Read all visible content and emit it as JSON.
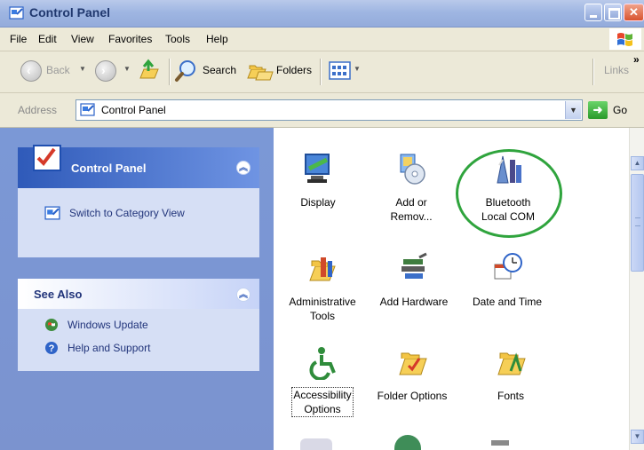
{
  "window": {
    "title": "Control Panel"
  },
  "menu": [
    "File",
    "Edit",
    "View",
    "Favorites",
    "Tools",
    "Help"
  ],
  "toolbar": {
    "back_label": "Back",
    "search_label": "Search",
    "folders_label": "Folders",
    "links_label": "Links",
    "more": "»"
  },
  "address": {
    "label": "Address",
    "value": "Control Panel",
    "go_label": "Go"
  },
  "tasks": {
    "title": "Control Panel",
    "switch_view": "Switch to Category View",
    "see_also_title": "See Also",
    "see_also": [
      "Windows Update",
      "Help and Support"
    ]
  },
  "items": [
    {
      "line1": "Display",
      "line2": ""
    },
    {
      "line1": "Add or",
      "line2": "Remov..."
    },
    {
      "line1": "Bluetooth",
      "line2": "Local COM"
    },
    {
      "line1": "Administrative",
      "line2": "Tools"
    },
    {
      "line1": "Add Hardware",
      "line2": ""
    },
    {
      "line1": "Date and Time",
      "line2": ""
    },
    {
      "line1": "Accessibility",
      "line2": "Options"
    },
    {
      "line1": "Folder Options",
      "line2": ""
    },
    {
      "line1": "Fonts",
      "line2": ""
    }
  ],
  "colors": {
    "highlight_ring": "#2fa43d",
    "task_pane": "#7b93cf"
  }
}
